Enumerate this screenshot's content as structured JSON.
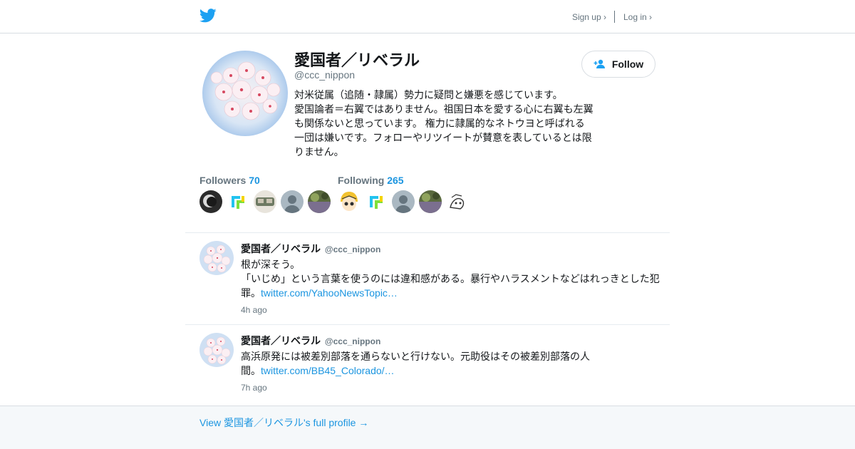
{
  "header": {
    "signup_label": "Sign up ›",
    "login_label": "Log in ›",
    "logo_icon": "twitter-bird-icon",
    "brand_color": "#1da1f2"
  },
  "profile": {
    "name": "愛国者／リベラル",
    "handle": "@ccc_nippon",
    "follow_label": "Follow",
    "bio_lines": [
      "対米従属（追随・隷属）勢力に疑問と嫌悪を感じています。",
      "愛国論者＝右翼ではありません。祖国日本を愛する心に右翼も左翼",
      "も関係ないと思っています。 権力に隷属的なネトウヨと呼ばれる",
      "一団は嫌いです。フォローやリツイートが賛意を表しているとは限",
      "りません。"
    ],
    "followers_label": "Followers",
    "followers_count": "70",
    "following_label": "Following",
    "following_count": "265"
  },
  "tweets": [
    {
      "name": "愛国者／リベラル",
      "handle": "@ccc_nippon",
      "line1": "根が深そう。",
      "line2": "「いじめ」という言葉を使うのには違和感がある。暴行やハラスメントなどはれっきとした犯",
      "line3_text": "罪。",
      "link": "twitter.com/YahooNewsTopic…",
      "time": "4h ago"
    },
    {
      "name": "愛国者／リベラル",
      "handle": "@ccc_nippon",
      "line1": "高浜原発には被差別部落を通らないと行けない。元助役はその被差別部落の人",
      "line2_text": "間。",
      "link": "twitter.com/BB45_Colorado/…",
      "time": "7h ago"
    }
  ],
  "footer": {
    "link_label": "View 愛国者／リベラル's full profile →"
  }
}
